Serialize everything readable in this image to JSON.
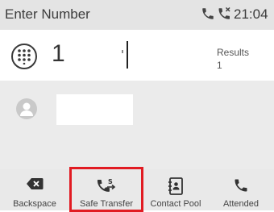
{
  "status_bar": {
    "title": "Enter Number",
    "time": "21:04",
    "icons": [
      "phone-icon",
      "missed-call-icon"
    ]
  },
  "input": {
    "icon": "keypad-icon",
    "value": "1",
    "results_label": "Results",
    "results_count": "1"
  },
  "results": {
    "items": [
      {
        "icon": "avatar-icon",
        "name": ""
      }
    ]
  },
  "softkeys": [
    {
      "label": "Backspace",
      "icon": "backspace-icon"
    },
    {
      "label": "Safe Transfer",
      "icon": "safe-transfer-icon",
      "highlighted": true
    },
    {
      "label": "Contact Pool",
      "icon": "contact-book-icon"
    },
    {
      "label": "Attended",
      "icon": "phone-icon"
    }
  ],
  "colors": {
    "status_bar": "#e4e4e4",
    "panel": "#ebebeb",
    "highlight": "#e11b22",
    "text": "#3a3a3a"
  }
}
